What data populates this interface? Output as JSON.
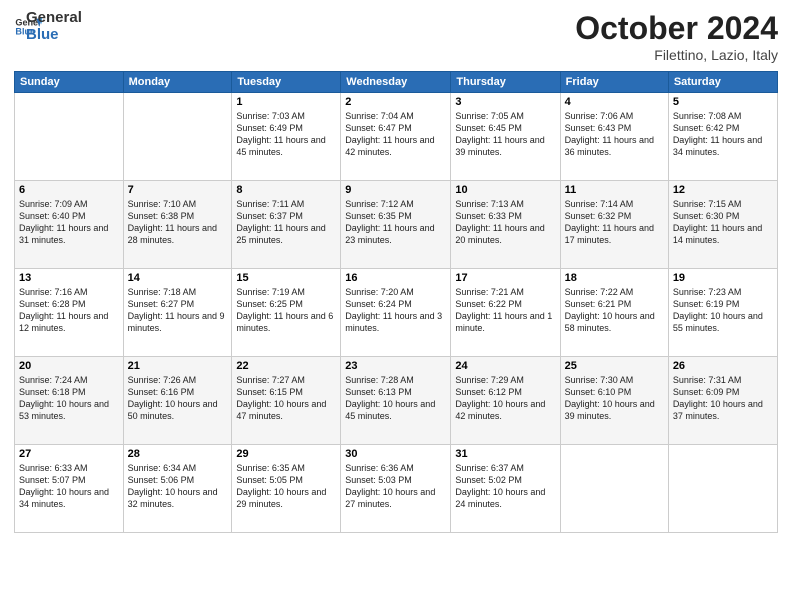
{
  "header": {
    "logo_general": "General",
    "logo_blue": "Blue",
    "title": "October 2024",
    "location": "Filettino, Lazio, Italy"
  },
  "days_of_week": [
    "Sunday",
    "Monday",
    "Tuesday",
    "Wednesday",
    "Thursday",
    "Friday",
    "Saturday"
  ],
  "weeks": [
    [
      {
        "day": "",
        "info": ""
      },
      {
        "day": "",
        "info": ""
      },
      {
        "day": "1",
        "info": "Sunrise: 7:03 AM\nSunset: 6:49 PM\nDaylight: 11 hours and 45 minutes."
      },
      {
        "day": "2",
        "info": "Sunrise: 7:04 AM\nSunset: 6:47 PM\nDaylight: 11 hours and 42 minutes."
      },
      {
        "day": "3",
        "info": "Sunrise: 7:05 AM\nSunset: 6:45 PM\nDaylight: 11 hours and 39 minutes."
      },
      {
        "day": "4",
        "info": "Sunrise: 7:06 AM\nSunset: 6:43 PM\nDaylight: 11 hours and 36 minutes."
      },
      {
        "day": "5",
        "info": "Sunrise: 7:08 AM\nSunset: 6:42 PM\nDaylight: 11 hours and 34 minutes."
      }
    ],
    [
      {
        "day": "6",
        "info": "Sunrise: 7:09 AM\nSunset: 6:40 PM\nDaylight: 11 hours and 31 minutes."
      },
      {
        "day": "7",
        "info": "Sunrise: 7:10 AM\nSunset: 6:38 PM\nDaylight: 11 hours and 28 minutes."
      },
      {
        "day": "8",
        "info": "Sunrise: 7:11 AM\nSunset: 6:37 PM\nDaylight: 11 hours and 25 minutes."
      },
      {
        "day": "9",
        "info": "Sunrise: 7:12 AM\nSunset: 6:35 PM\nDaylight: 11 hours and 23 minutes."
      },
      {
        "day": "10",
        "info": "Sunrise: 7:13 AM\nSunset: 6:33 PM\nDaylight: 11 hours and 20 minutes."
      },
      {
        "day": "11",
        "info": "Sunrise: 7:14 AM\nSunset: 6:32 PM\nDaylight: 11 hours and 17 minutes."
      },
      {
        "day": "12",
        "info": "Sunrise: 7:15 AM\nSunset: 6:30 PM\nDaylight: 11 hours and 14 minutes."
      }
    ],
    [
      {
        "day": "13",
        "info": "Sunrise: 7:16 AM\nSunset: 6:28 PM\nDaylight: 11 hours and 12 minutes."
      },
      {
        "day": "14",
        "info": "Sunrise: 7:18 AM\nSunset: 6:27 PM\nDaylight: 11 hours and 9 minutes."
      },
      {
        "day": "15",
        "info": "Sunrise: 7:19 AM\nSunset: 6:25 PM\nDaylight: 11 hours and 6 minutes."
      },
      {
        "day": "16",
        "info": "Sunrise: 7:20 AM\nSunset: 6:24 PM\nDaylight: 11 hours and 3 minutes."
      },
      {
        "day": "17",
        "info": "Sunrise: 7:21 AM\nSunset: 6:22 PM\nDaylight: 11 hours and 1 minute."
      },
      {
        "day": "18",
        "info": "Sunrise: 7:22 AM\nSunset: 6:21 PM\nDaylight: 10 hours and 58 minutes."
      },
      {
        "day": "19",
        "info": "Sunrise: 7:23 AM\nSunset: 6:19 PM\nDaylight: 10 hours and 55 minutes."
      }
    ],
    [
      {
        "day": "20",
        "info": "Sunrise: 7:24 AM\nSunset: 6:18 PM\nDaylight: 10 hours and 53 minutes."
      },
      {
        "day": "21",
        "info": "Sunrise: 7:26 AM\nSunset: 6:16 PM\nDaylight: 10 hours and 50 minutes."
      },
      {
        "day": "22",
        "info": "Sunrise: 7:27 AM\nSunset: 6:15 PM\nDaylight: 10 hours and 47 minutes."
      },
      {
        "day": "23",
        "info": "Sunrise: 7:28 AM\nSunset: 6:13 PM\nDaylight: 10 hours and 45 minutes."
      },
      {
        "day": "24",
        "info": "Sunrise: 7:29 AM\nSunset: 6:12 PM\nDaylight: 10 hours and 42 minutes."
      },
      {
        "day": "25",
        "info": "Sunrise: 7:30 AM\nSunset: 6:10 PM\nDaylight: 10 hours and 39 minutes."
      },
      {
        "day": "26",
        "info": "Sunrise: 7:31 AM\nSunset: 6:09 PM\nDaylight: 10 hours and 37 minutes."
      }
    ],
    [
      {
        "day": "27",
        "info": "Sunrise: 6:33 AM\nSunset: 5:07 PM\nDaylight: 10 hours and 34 minutes."
      },
      {
        "day": "28",
        "info": "Sunrise: 6:34 AM\nSunset: 5:06 PM\nDaylight: 10 hours and 32 minutes."
      },
      {
        "day": "29",
        "info": "Sunrise: 6:35 AM\nSunset: 5:05 PM\nDaylight: 10 hours and 29 minutes."
      },
      {
        "day": "30",
        "info": "Sunrise: 6:36 AM\nSunset: 5:03 PM\nDaylight: 10 hours and 27 minutes."
      },
      {
        "day": "31",
        "info": "Sunrise: 6:37 AM\nSunset: 5:02 PM\nDaylight: 10 hours and 24 minutes."
      },
      {
        "day": "",
        "info": ""
      },
      {
        "day": "",
        "info": ""
      }
    ]
  ]
}
